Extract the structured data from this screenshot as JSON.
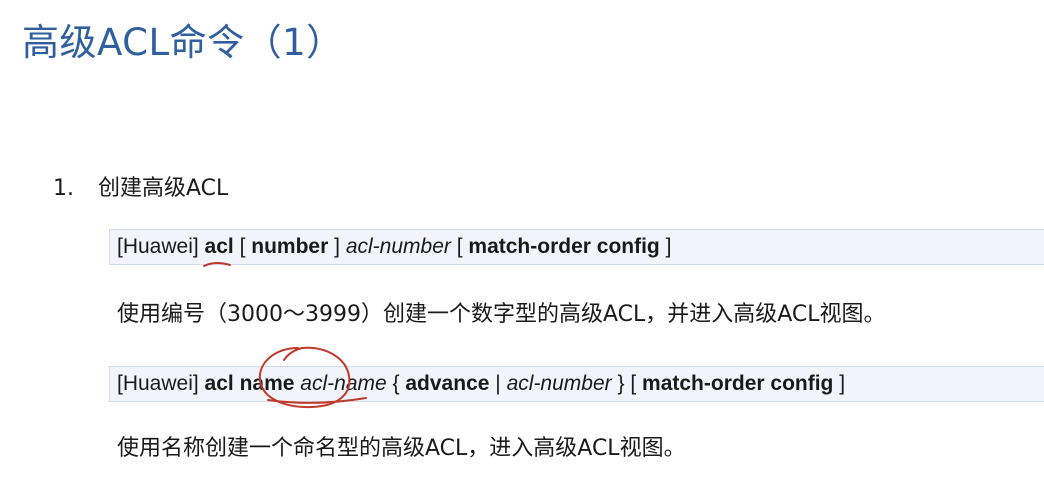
{
  "title": "高级ACL命令（1）",
  "item1": {
    "number": "1.",
    "label": "创建高级ACL"
  },
  "cmd1": {
    "prompt": "[Huawei]",
    "kw_acl": "acl",
    "br_open": "[",
    "kw_number": "number",
    "br_close": "]",
    "arg": "acl-number",
    "br2_open": "[",
    "kw_match": "match-order config",
    "br2_close": "]"
  },
  "desc1": "使用编号（3000～3999）创建一个数字型的高级ACL，并进入高级ACL视图。",
  "cmd2": {
    "prompt": "[Huawei]",
    "kw_acl": "acl",
    "kw_name": "name",
    "arg_name": "acl-name",
    "brace_open": "{",
    "kw_advance": "advance",
    "pipe": "|",
    "arg_number": "acl-number",
    "brace_close": "}",
    "br_open": "[",
    "kw_match": "match-order config",
    "br_close": "]"
  },
  "desc2": "使用名称创建一个命名型的高级ACL，进入高级ACL视图。",
  "colors": {
    "title": "#2f5f9e",
    "command_background": "#f1f5fb",
    "annotation": "#c0392b"
  }
}
